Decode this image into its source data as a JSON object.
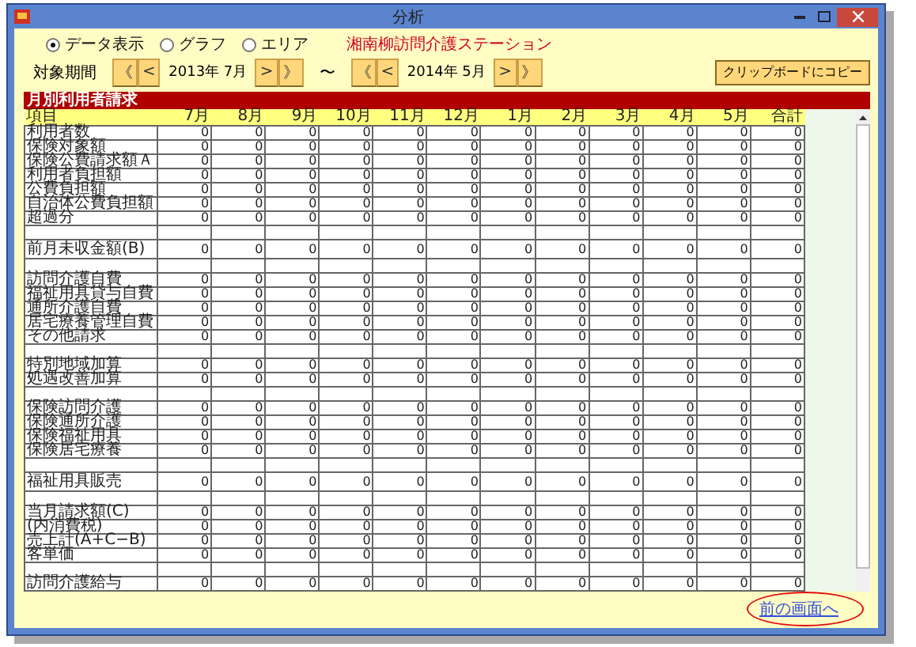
{
  "window": {
    "title": "分析"
  },
  "views": [
    {
      "label": "データ表示",
      "selected": true
    },
    {
      "label": "グラフ",
      "selected": false
    },
    {
      "label": "エリア",
      "selected": false
    }
  ],
  "station": "湘南柳訪問介護ステーション",
  "period": {
    "label": "対象期間",
    "start": {
      "first": "《",
      "prev": "<",
      "value": "2013年 7月",
      "next": ">",
      "last": "》"
    },
    "separator": "〜",
    "end": {
      "first": "《",
      "prev": "<",
      "value": "2014年 5月",
      "next": ">",
      "last": "》"
    }
  },
  "copy_button": "クリップボードにコピー",
  "section_title": "月別利用者請求",
  "table": {
    "columns": [
      "項目",
      "7月",
      "8月",
      "9月",
      "10月",
      "11月",
      "12月",
      "1月",
      "2月",
      "3月",
      "4月",
      "5月",
      "合計"
    ],
    "rows": [
      {
        "kind": "data",
        "label": "利用者数",
        "values": [
          "0",
          "0",
          "0",
          "0",
          "0",
          "0",
          "0",
          "0",
          "0",
          "0",
          "0",
          "0"
        ]
      },
      {
        "kind": "data",
        "label": "保険対象額",
        "values": [
          "0",
          "0",
          "0",
          "0",
          "0",
          "0",
          "0",
          "0",
          "0",
          "0",
          "0",
          "0"
        ]
      },
      {
        "kind": "data",
        "label": "保険公費請求額Ａ",
        "values": [
          "0",
          "0",
          "0",
          "0",
          "0",
          "0",
          "0",
          "0",
          "0",
          "0",
          "0",
          "0"
        ]
      },
      {
        "kind": "data",
        "label": "利用者負担額",
        "values": [
          "0",
          "0",
          "0",
          "0",
          "0",
          "0",
          "0",
          "0",
          "0",
          "0",
          "0",
          "0"
        ]
      },
      {
        "kind": "data",
        "label": "公費負担額",
        "values": [
          "0",
          "0",
          "0",
          "0",
          "0",
          "0",
          "0",
          "0",
          "0",
          "0",
          "0",
          "0"
        ]
      },
      {
        "kind": "data",
        "label": "自治体公費負担額",
        "values": [
          "0",
          "0",
          "0",
          "0",
          "0",
          "0",
          "0",
          "0",
          "0",
          "0",
          "0",
          "0"
        ]
      },
      {
        "kind": "data",
        "label": "超過分",
        "values": [
          "0",
          "0",
          "0",
          "0",
          "0",
          "0",
          "0",
          "0",
          "0",
          "0",
          "0",
          "0"
        ]
      },
      {
        "kind": "blank"
      },
      {
        "kind": "tall",
        "label": "前月未収金額(B)",
        "values": [
          "0",
          "0",
          "0",
          "0",
          "0",
          "0",
          "0",
          "0",
          "0",
          "0",
          "0",
          "0"
        ]
      },
      {
        "kind": "blank"
      },
      {
        "kind": "data",
        "label": "訪問介護自費",
        "values": [
          "0",
          "0",
          "0",
          "0",
          "0",
          "0",
          "0",
          "0",
          "0",
          "0",
          "0",
          "0"
        ]
      },
      {
        "kind": "data",
        "label": "福祉用具貸与自費",
        "values": [
          "0",
          "0",
          "0",
          "0",
          "0",
          "0",
          "0",
          "0",
          "0",
          "0",
          "0",
          "0"
        ]
      },
      {
        "kind": "data",
        "label": "通所介護自費",
        "values": [
          "0",
          "0",
          "0",
          "0",
          "0",
          "0",
          "0",
          "0",
          "0",
          "0",
          "0",
          "0"
        ]
      },
      {
        "kind": "data",
        "label": "居宅療養管理自費",
        "values": [
          "0",
          "0",
          "0",
          "0",
          "0",
          "0",
          "0",
          "0",
          "0",
          "0",
          "0",
          "0"
        ]
      },
      {
        "kind": "data",
        "label": "その他請求",
        "values": [
          "0",
          "0",
          "0",
          "0",
          "0",
          "0",
          "0",
          "0",
          "0",
          "0",
          "0",
          "0"
        ]
      },
      {
        "kind": "blank"
      },
      {
        "kind": "data",
        "label": "特別地域加算",
        "values": [
          "0",
          "0",
          "0",
          "0",
          "0",
          "0",
          "0",
          "0",
          "0",
          "0",
          "0",
          "0"
        ]
      },
      {
        "kind": "data",
        "label": "処遇改善加算",
        "values": [
          "0",
          "0",
          "0",
          "0",
          "0",
          "0",
          "0",
          "0",
          "0",
          "0",
          "0",
          "0"
        ]
      },
      {
        "kind": "blank"
      },
      {
        "kind": "data",
        "label": "保険訪問介護",
        "values": [
          "0",
          "0",
          "0",
          "0",
          "0",
          "0",
          "0",
          "0",
          "0",
          "0",
          "0",
          "0"
        ]
      },
      {
        "kind": "data",
        "label": "保険通所介護",
        "values": [
          "0",
          "0",
          "0",
          "0",
          "0",
          "0",
          "0",
          "0",
          "0",
          "0",
          "0",
          "0"
        ]
      },
      {
        "kind": "data",
        "label": "保険福祉用具",
        "values": [
          "0",
          "0",
          "0",
          "0",
          "0",
          "0",
          "0",
          "0",
          "0",
          "0",
          "0",
          "0"
        ]
      },
      {
        "kind": "data",
        "label": "保険居宅療養",
        "values": [
          "0",
          "0",
          "0",
          "0",
          "0",
          "0",
          "0",
          "0",
          "0",
          "0",
          "0",
          "0"
        ]
      },
      {
        "kind": "blank"
      },
      {
        "kind": "tall",
        "label": "福祉用具販売",
        "values": [
          "0",
          "0",
          "0",
          "0",
          "0",
          "0",
          "0",
          "0",
          "0",
          "0",
          "0",
          "0"
        ]
      },
      {
        "kind": "blank"
      },
      {
        "kind": "data",
        "label": "当月請求額(C)",
        "values": [
          "0",
          "0",
          "0",
          "0",
          "0",
          "0",
          "0",
          "0",
          "0",
          "0",
          "0",
          "0"
        ]
      },
      {
        "kind": "data",
        "label": "(内消費税)",
        "values": [
          "0",
          "0",
          "0",
          "0",
          "0",
          "0",
          "0",
          "0",
          "0",
          "0",
          "0",
          "0"
        ]
      },
      {
        "kind": "data",
        "label": "売上計(A+C−B)",
        "values": [
          "0",
          "0",
          "0",
          "0",
          "0",
          "0",
          "0",
          "0",
          "0",
          "0",
          "0",
          "0"
        ]
      },
      {
        "kind": "data",
        "label": "客単価",
        "values": [
          "0",
          "0",
          "0",
          "0",
          "0",
          "0",
          "0",
          "0",
          "0",
          "0",
          "0",
          "0"
        ]
      },
      {
        "kind": "blank"
      },
      {
        "kind": "data",
        "label": "訪問介護給与",
        "values": [
          "0",
          "0",
          "0",
          "0",
          "0",
          "0",
          "0",
          "0",
          "0",
          "0",
          "0",
          "0"
        ]
      }
    ]
  },
  "back_link": "前の画面へ"
}
